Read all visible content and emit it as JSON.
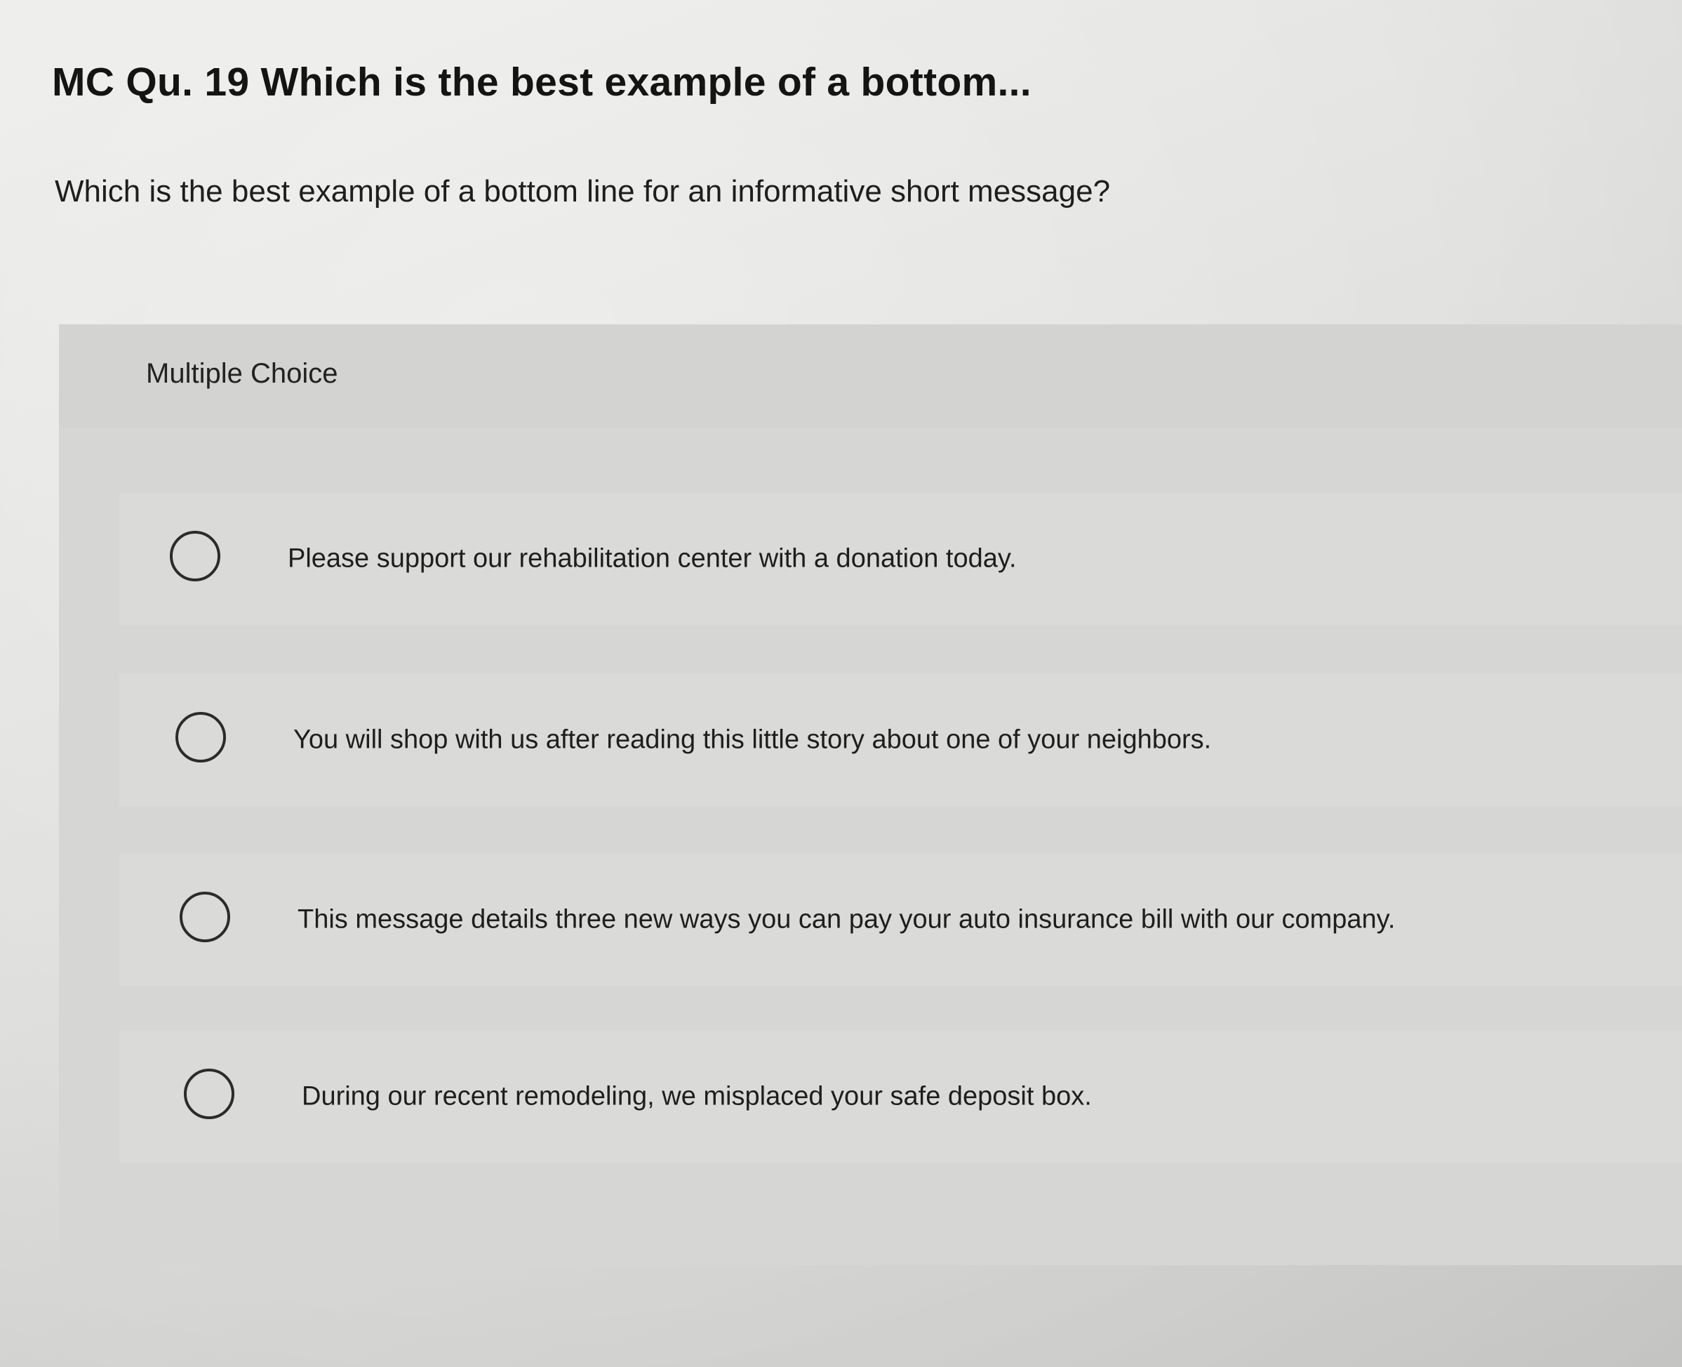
{
  "question": {
    "title": "MC Qu. 19 Which is the best example of a bottom...",
    "prompt": "Which is the best example of a bottom line for an informative short message?"
  },
  "multiple_choice": {
    "label": "Multiple Choice",
    "options": [
      {
        "text": "Please support our rehabilitation center with a donation today.",
        "selected": false
      },
      {
        "text": "You will shop with us after reading this little story about one of your neighbors.",
        "selected": false
      },
      {
        "text": "This message details three new ways you can pay your auto insurance bill with our company.",
        "selected": false
      },
      {
        "text": "During our recent remodeling, we misplaced your safe deposit box.",
        "selected": false
      }
    ]
  }
}
